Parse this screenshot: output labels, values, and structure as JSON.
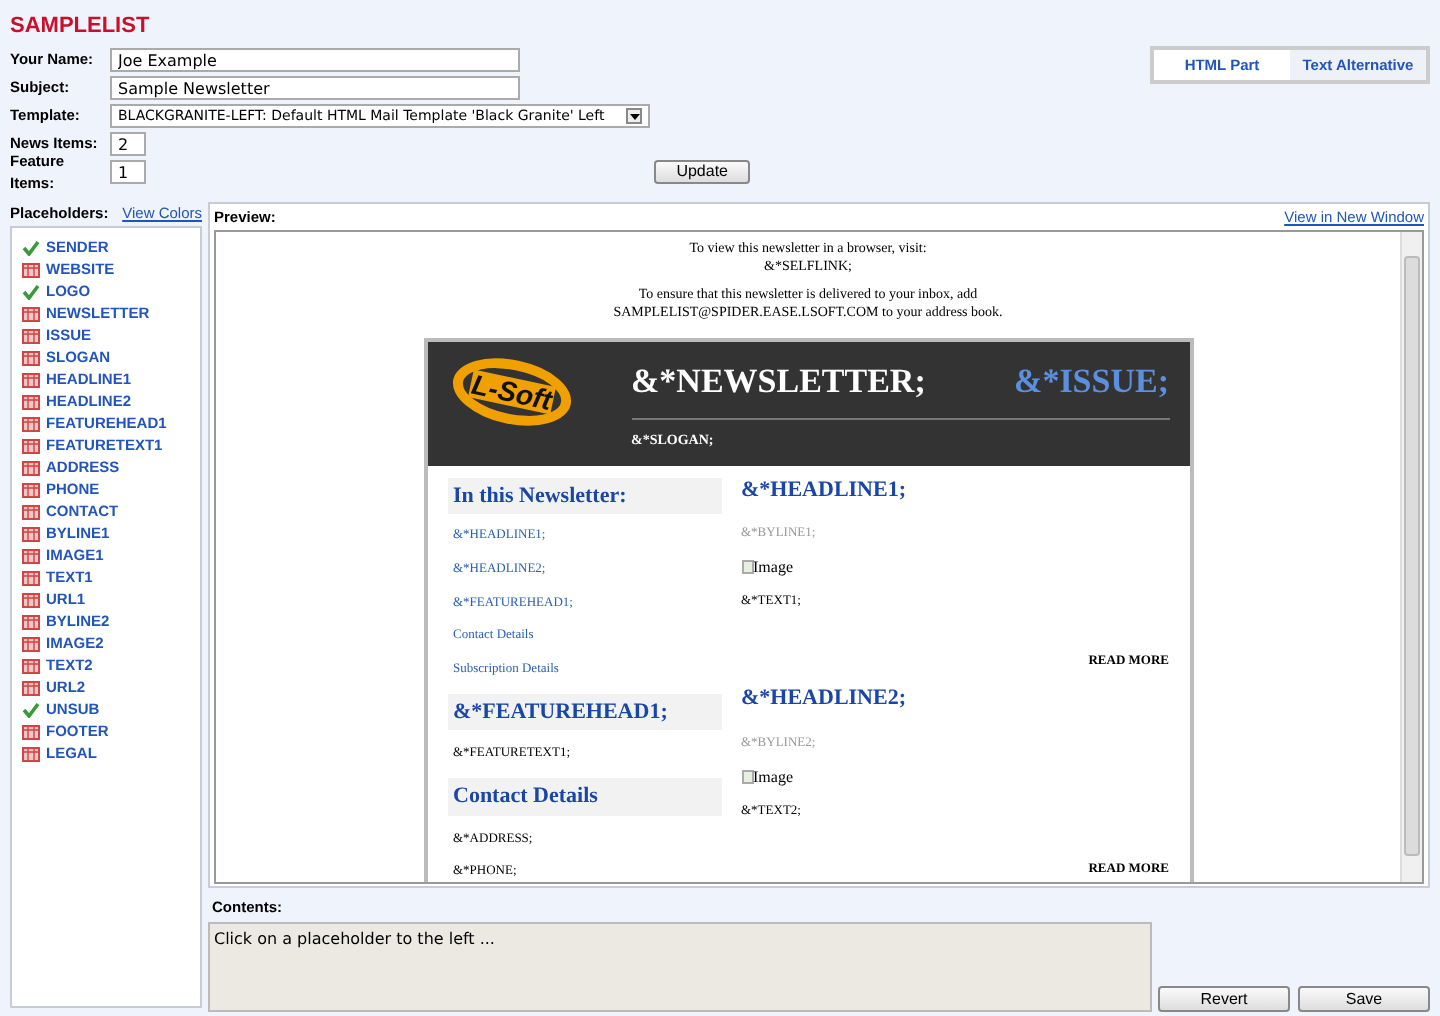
{
  "app_title": "SAMPLELIST",
  "form": {
    "fields": [
      {
        "label": "Your Name:",
        "value": "Joe Example",
        "kind": "text"
      },
      {
        "label": "Subject:",
        "value": "Sample Newsletter",
        "kind": "text"
      },
      {
        "label": "Template:",
        "value": "BLACKGRANITE-LEFT: Default HTML Mail Template 'Black Granite' Left",
        "kind": "select"
      },
      {
        "label": "News Items:",
        "value": "2",
        "kind": "number"
      },
      {
        "label": "Feature Items:",
        "value": "1",
        "kind": "number"
      }
    ],
    "update_button": "Update"
  },
  "tabs": [
    {
      "label": "HTML Part",
      "selected": true
    },
    {
      "label": "Text Alternative",
      "selected": false
    }
  ],
  "placeholders": {
    "title": "Placeholders:",
    "link": "View Colors",
    "items": [
      {
        "label": "SENDER",
        "set": true
      },
      {
        "label": "WEBSITE",
        "set": false
      },
      {
        "label": "LOGO",
        "set": true
      },
      {
        "label": "NEWSLETTER",
        "set": false
      },
      {
        "label": "ISSUE",
        "set": false
      },
      {
        "label": "SLOGAN",
        "set": false
      },
      {
        "label": "HEADLINE1",
        "set": false
      },
      {
        "label": "HEADLINE2",
        "set": false
      },
      {
        "label": "FEATUREHEAD1",
        "set": false
      },
      {
        "label": "FEATURETEXT1",
        "set": false
      },
      {
        "label": "ADDRESS",
        "set": false
      },
      {
        "label": "PHONE",
        "set": false
      },
      {
        "label": "CONTACT",
        "set": false
      },
      {
        "label": "BYLINE1",
        "set": false
      },
      {
        "label": "IMAGE1",
        "set": false
      },
      {
        "label": "TEXT1",
        "set": false
      },
      {
        "label": "URL1",
        "set": false
      },
      {
        "label": "BYLINE2",
        "set": false
      },
      {
        "label": "IMAGE2",
        "set": false
      },
      {
        "label": "TEXT2",
        "set": false
      },
      {
        "label": "URL2",
        "set": false
      },
      {
        "label": "UNSUB",
        "set": true
      },
      {
        "label": "FOOTER",
        "set": false
      },
      {
        "label": "LEGAL",
        "set": false
      }
    ]
  },
  "preview": {
    "title": "Preview:",
    "link": "View in New Window",
    "intro": [
      "To view this newsletter in a browser, visit:",
      "&*SELFLINK;",
      "To ensure that this newsletter is delivered to your inbox, add",
      "SAMPLELIST@SPIDER.EASE.LSOFT.COM to your address book."
    ],
    "logo_text": "L-Soft",
    "newsletter": "&*NEWSLETTER;",
    "issue": "&*ISSUE;",
    "slogan": "&*SLOGAN;",
    "sidebar": [
      {
        "heading": "In this Newsletter:",
        "links": [
          "&*HEADLINE1;",
          "&*HEADLINE2;",
          "&*FEATUREHEAD1;",
          "Contact Details",
          "Subscription Details"
        ]
      },
      {
        "heading": "&*FEATUREHEAD1;",
        "text": [
          "&*FEATURETEXT1;"
        ]
      },
      {
        "heading": "Contact Details",
        "text": [
          "&*ADDRESS;",
          "&*PHONE;"
        ]
      }
    ],
    "articles": [
      {
        "headline": "&*HEADLINE1;",
        "byline": "&*BYLINE1;",
        "image": "Image",
        "text": "&*TEXT1;",
        "more": "READ MORE"
      },
      {
        "headline": "&*HEADLINE2;",
        "byline": "&*BYLINE2;",
        "image": "Image",
        "text": "&*TEXT2;",
        "more": "READ MORE"
      }
    ]
  },
  "contents": {
    "label": "Contents:",
    "value": "Click on a placeholder to the left ...",
    "disabled": true
  },
  "buttons": [
    "Revert",
    "Save"
  ]
}
